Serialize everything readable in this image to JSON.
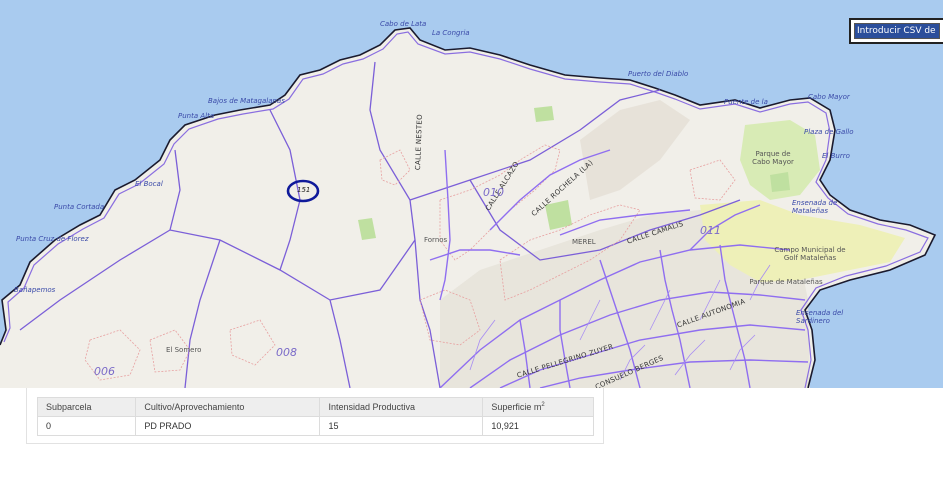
{
  "map": {
    "coast_labels": {
      "cabo_de_lata": "Cabo de Lata",
      "la_congria": "La Congria",
      "puerto_del_diablo": "Puerto del Diablo",
      "bajos_de_matagalanas": "Bajos de Matagalanas",
      "punta_alta": "Punta Alta",
      "puente_de_la": "Puente de la",
      "cabo_mayor": "Cabo Mayor",
      "playa_de_gallo": "Plaza de Gallo",
      "el_burro": "El Burro",
      "el_bocal": "El Bocal",
      "punta_cortada": "Punta Cortada",
      "punta_cruz_de_florez": "Punta Cruz de Florez",
      "banapemos": "Bañapemos",
      "ensenada_de_matalenas": "Ensenada de Mataleñas",
      "ensenada_del_sardinero": "Ensenada del Sardinero"
    },
    "street_labels": {
      "calle_nesteo": "CALLE NESTEO",
      "calle_alcazo": "CALLE ALCAZO",
      "calle_rochela": "CALLE ROCHELA (LA)",
      "calle_camalis": "CALLE CAMALIS",
      "calle_autonomia": "CALLE AUTONOMIA",
      "calle_pellegrino_zuyer": "CALLE PELLEGRINO ZUYER",
      "consuelo_berges": "CONSUELO BERGES"
    },
    "zone_labels": {
      "z010": "010",
      "z011": "011",
      "z008": "008",
      "z006": "006"
    },
    "place_labels": {
      "parque_cabo_mayor": "Parque de Cabo Mayor",
      "campo_golf": "Campo Municipal de Golf Mataleñas",
      "parque_matalenas": "Parque de Mataleñas",
      "merel": "MEREL",
      "fornos": "Fornos",
      "el_somero": "El Somero"
    },
    "parcel_label": "151"
  },
  "csv_input": {
    "value": "Introducir CSV de IV"
  },
  "table": {
    "headers": [
      "Subparcela",
      "Cultivo/Aprovechamiento",
      "Intensidad Productiva",
      "Superficie m"
    ],
    "area_unit_exp": "2",
    "rows": [
      {
        "subparcela": "0",
        "cultivo": "PD PRADO",
        "intensidad": "15",
        "superficie": "10,921"
      }
    ]
  }
}
